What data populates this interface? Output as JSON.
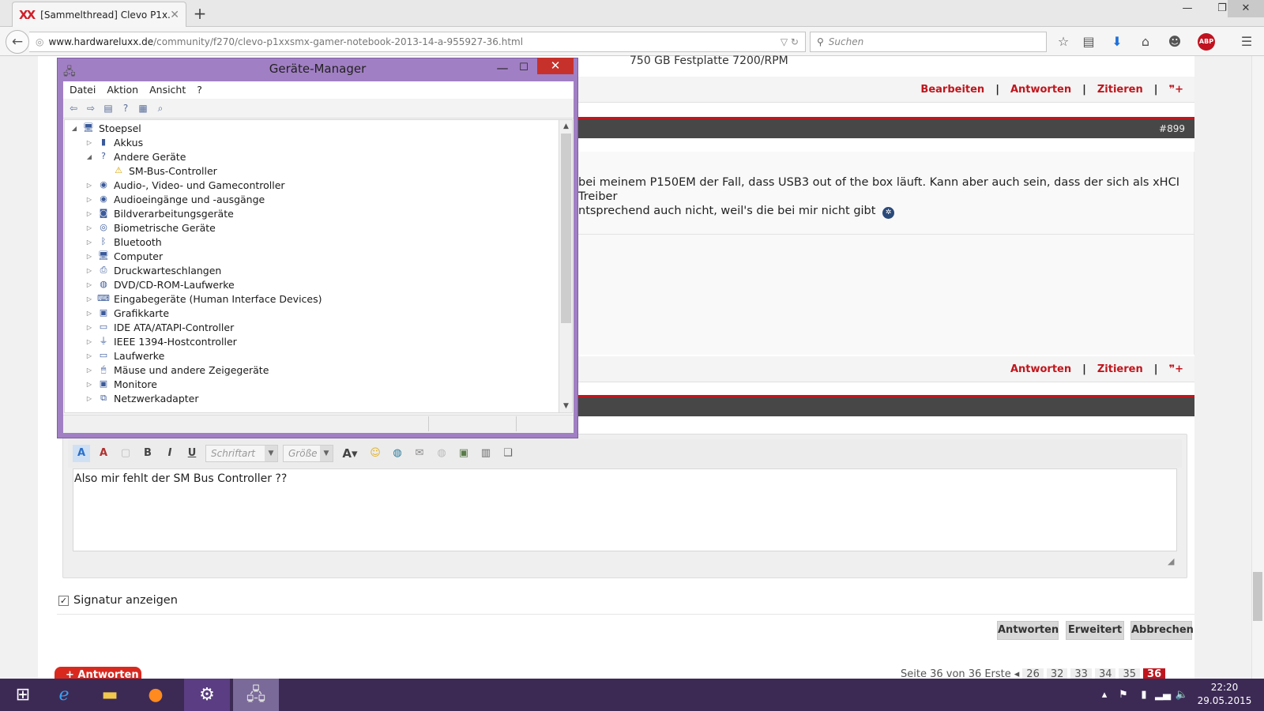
{
  "browser": {
    "tab_title": "[Sammelthread] Clevo P1x...",
    "tab_favicon": "XX",
    "new_tab": "+",
    "url_host": "www.hardwareluxx.de",
    "url_path": "/community/f270/clevo-p1xxsmx-gamer-notebook-2013-14-a-955927-36.html",
    "search_placeholder": "Suchen",
    "abp_label": "ABP"
  },
  "post": {
    "festplatte": "750 GB Festplatte 7200/RPM",
    "actions_top": [
      "Bearbeiten",
      "Antworten",
      "Zitieren"
    ],
    "post_number": "#899",
    "text_line1": "bei meinem P150EM der Fall, dass USB3 out of the box läuft. Kann aber auch sein, dass der sich als xHCI Treiber",
    "text_line2": "ntsprechend auch nicht, weil's die bei mir nicht gibt",
    "actions_bottom": [
      "Antworten",
      "Zitieren"
    ]
  },
  "editor": {
    "font_select": "Schriftart",
    "size_select": "Größe",
    "text": "Also mir fehlt der SM Bus Controller ??",
    "signature_label": "Signatur anzeigen",
    "buttons": [
      "Antworten",
      "Erweitert",
      "Abbrechen"
    ],
    "reply_big": "+ Antworten"
  },
  "pager": {
    "label": "Seite 36 von 36",
    "first": "Erste",
    "pages": [
      "26",
      "32",
      "33",
      "34",
      "35",
      "36"
    ]
  },
  "device_manager": {
    "title": "Geräte-Manager",
    "menu": [
      "Datei",
      "Aktion",
      "Ansicht",
      "?"
    ],
    "tree": [
      {
        "label": "Stoepsel",
        "level": 0,
        "expanded": true,
        "icon": "computer-icon"
      },
      {
        "label": "Akkus",
        "level": 1,
        "expanded": false,
        "icon": "battery-icon"
      },
      {
        "label": "Andere Geräte",
        "level": 1,
        "expanded": true,
        "icon": "unknown-device-icon"
      },
      {
        "label": "SM-Bus-Controller",
        "level": 2,
        "expanded": null,
        "icon": "warning-device-icon"
      },
      {
        "label": "Audio-, Video- und Gamecontroller",
        "level": 1,
        "expanded": false,
        "icon": "speaker-icon"
      },
      {
        "label": "Audioeingänge und -ausgänge",
        "level": 1,
        "expanded": false,
        "icon": "speaker-icon"
      },
      {
        "label": "Bildverarbeitungsgeräte",
        "level": 1,
        "expanded": false,
        "icon": "camera-icon"
      },
      {
        "label": "Biometrische Geräte",
        "level": 1,
        "expanded": false,
        "icon": "fingerprint-icon"
      },
      {
        "label": "Bluetooth",
        "level": 1,
        "expanded": false,
        "icon": "bluetooth-icon"
      },
      {
        "label": "Computer",
        "level": 1,
        "expanded": false,
        "icon": "computer-icon"
      },
      {
        "label": "Druckwarteschlangen",
        "level": 1,
        "expanded": false,
        "icon": "printer-icon"
      },
      {
        "label": "DVD/CD-ROM-Laufwerke",
        "level": 1,
        "expanded": false,
        "icon": "disc-icon"
      },
      {
        "label": "Eingabegeräte (Human Interface Devices)",
        "level": 1,
        "expanded": false,
        "icon": "hid-icon"
      },
      {
        "label": "Grafikkarte",
        "level": 1,
        "expanded": false,
        "icon": "monitor-icon"
      },
      {
        "label": "IDE ATA/ATAPI-Controller",
        "level": 1,
        "expanded": false,
        "icon": "drive-icon"
      },
      {
        "label": "IEEE 1394-Hostcontroller",
        "level": 1,
        "expanded": false,
        "icon": "firewire-icon"
      },
      {
        "label": "Laufwerke",
        "level": 1,
        "expanded": false,
        "icon": "drive-icon"
      },
      {
        "label": "Mäuse und andere Zeigegeräte",
        "level": 1,
        "expanded": false,
        "icon": "mouse-icon"
      },
      {
        "label": "Monitore",
        "level": 1,
        "expanded": false,
        "icon": "monitor-icon"
      },
      {
        "label": "Netzwerkadapter",
        "level": 1,
        "expanded": false,
        "icon": "network-icon"
      }
    ]
  },
  "taskbar": {
    "time": "22:20",
    "date": "29.05.2015"
  },
  "colors": {
    "accent_red": "#c0161d",
    "dm_frame": "#a17fc4",
    "taskbar": "#3c2a55"
  }
}
